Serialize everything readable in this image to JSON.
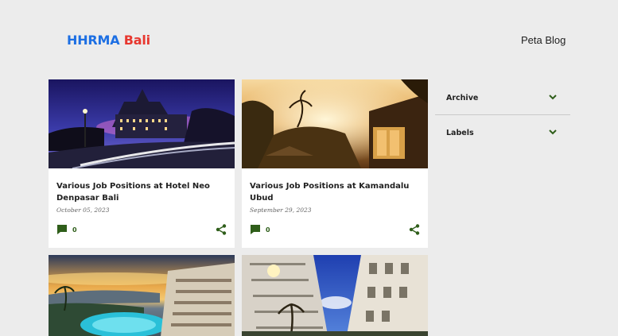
{
  "header": {
    "logo_part1": "HHRMA",
    "logo_part2": "Bali",
    "nav_label": "Peta Blog"
  },
  "posts": [
    {
      "title": "Various Job Positions at Hotel Neo Denpasar Bali",
      "date": "October 05, 2023",
      "comments": "0"
    },
    {
      "title": "Various Job Positions at Kamandalu Ubud",
      "date": "September 29, 2023",
      "comments": "0"
    }
  ],
  "sidebar": {
    "items": [
      {
        "label": "Archive"
      },
      {
        "label": "Labels"
      }
    ]
  },
  "colors": {
    "logo_blue": "#1d6fe3",
    "logo_red": "#e7372f",
    "icon_green": "#2f5e1a"
  },
  "icons": [
    "comment-icon",
    "share-icon",
    "chevron-down-icon"
  ]
}
